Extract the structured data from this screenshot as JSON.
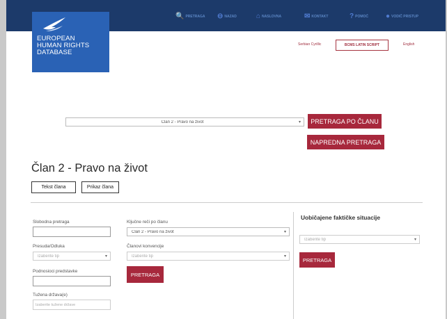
{
  "nav": {
    "items": [
      {
        "label": "PRETRAGA",
        "icon": "search-icon",
        "glyph": "🔍"
      },
      {
        "label": "NAZAD",
        "icon": "back-arrow-icon",
        "glyph": "⊖"
      },
      {
        "label": "NASLOVNA",
        "icon": "home-icon",
        "glyph": "⌂"
      },
      {
        "label": "KONTAKT",
        "icon": "mail-icon",
        "glyph": "✉"
      },
      {
        "label": "POMOĆ",
        "icon": "help-icon",
        "glyph": "?"
      },
      {
        "label": "VODIČ PRISTUP",
        "icon": "guide-icon",
        "glyph": "●"
      }
    ]
  },
  "logo": {
    "lines": [
      "EUROPEAN",
      "HUMAN RIGHTS",
      "DATABASE"
    ]
  },
  "languages": {
    "cyrillic": "Serbian Cyrillic",
    "latin": "BCMS LATIN SCRIPT",
    "english": "English"
  },
  "article_select": {
    "value": "Član 2 - Pravo na život"
  },
  "buttons": {
    "search_by_article": "PRETRAGA PO ČLANU",
    "advanced_search": "NAPREDNA PRETRAGA",
    "search": "PRETRAGA"
  },
  "page": {
    "title": "Član 2 - Pravo na život",
    "text_button": "Tekst člana",
    "display_button": "Prikaz člana"
  },
  "filters": {
    "free_search": "Slobodna pretraga",
    "judgment_label": "Presuda/Odluka",
    "judgment_placeholder": "Izaberite tip",
    "applicants_label": "Podnosioci predstavke",
    "respondent_label": "Tužena država(e)",
    "respondent_placeholder": "Izaberite tužene države",
    "keywords_label": "Ključne reči po članu",
    "keywords_value": "Član 2 - Pravo na život",
    "convention_label": "Članovi konvencije",
    "convention_placeholder": "Izaberite tip"
  },
  "facts": {
    "heading": "Uobičajene faktičke situacije",
    "placeholder": "Izaberite tip"
  },
  "colors": {
    "topbar": "#1c3a6a",
    "logo": "#2a62b5",
    "accent_red": "#a7283c"
  }
}
